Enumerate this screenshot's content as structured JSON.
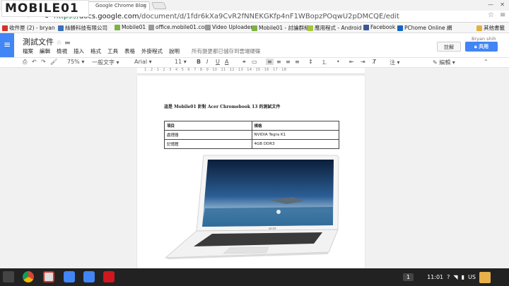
{
  "browser": {
    "tabs": [
      {
        "title": "Google Chrome Blog"
      }
    ],
    "url": {
      "proto": "https://",
      "domain": "docs.google.com",
      "path": "/document/d/1fdr6kXa9CvR2fNNEKGKfp4nF1WBopzPOqwU2pDMCQE/edit"
    },
    "bookmarks": [
      {
        "label": "收件匣 (2) - bryan",
        "color": "#d93025"
      },
      {
        "label": "絲勝科技有限公司",
        "color": "#3b6fb6"
      },
      {
        "label": "Mobile01",
        "color": "#7cb342"
      },
      {
        "label": "office.mobile01.cor",
        "color": "#999999"
      },
      {
        "label": "Video Uploader",
        "color": "#999999"
      },
      {
        "label": "Mobile01 - 討論群組",
        "color": "#7cb342"
      },
      {
        "label": "應用程式 - Android",
        "color": "#a4c639"
      },
      {
        "label": "Facebook",
        "color": "#3b5998"
      },
      {
        "label": "PChome Online 網",
        "color": "#1565c0"
      }
    ],
    "other_bookmarks": "其他書籤",
    "logo_text": "MOBILE01"
  },
  "docs": {
    "title": "測試文件",
    "menu": [
      "檔案",
      "編輯",
      "檢視",
      "插入",
      "格式",
      "工具",
      "表格",
      "外掛程式",
      "說明"
    ],
    "save_status": "所有變更都已儲存到雲端硬碟",
    "user": "Bryan shih",
    "comment_btn": "註解",
    "share_btn": "共用",
    "toolbar": {
      "zoom": "75%",
      "style": "一般文字",
      "font": "Arial",
      "size": "11",
      "mode": "編輯"
    }
  },
  "document": {
    "heading": "這是 Mobile01 針對 Acer Chromebook 13 的測試文件",
    "table": {
      "headers": [
        "項目",
        "規格"
      ],
      "rows": [
        [
          "處理器",
          "NVIDIA Tegra K1"
        ],
        [
          "記憶體",
          "4GB DDR3"
        ]
      ]
    },
    "laptop_brand": "acer"
  },
  "shelf": {
    "page_count": "1",
    "time": "11:01",
    "locale": "US"
  }
}
